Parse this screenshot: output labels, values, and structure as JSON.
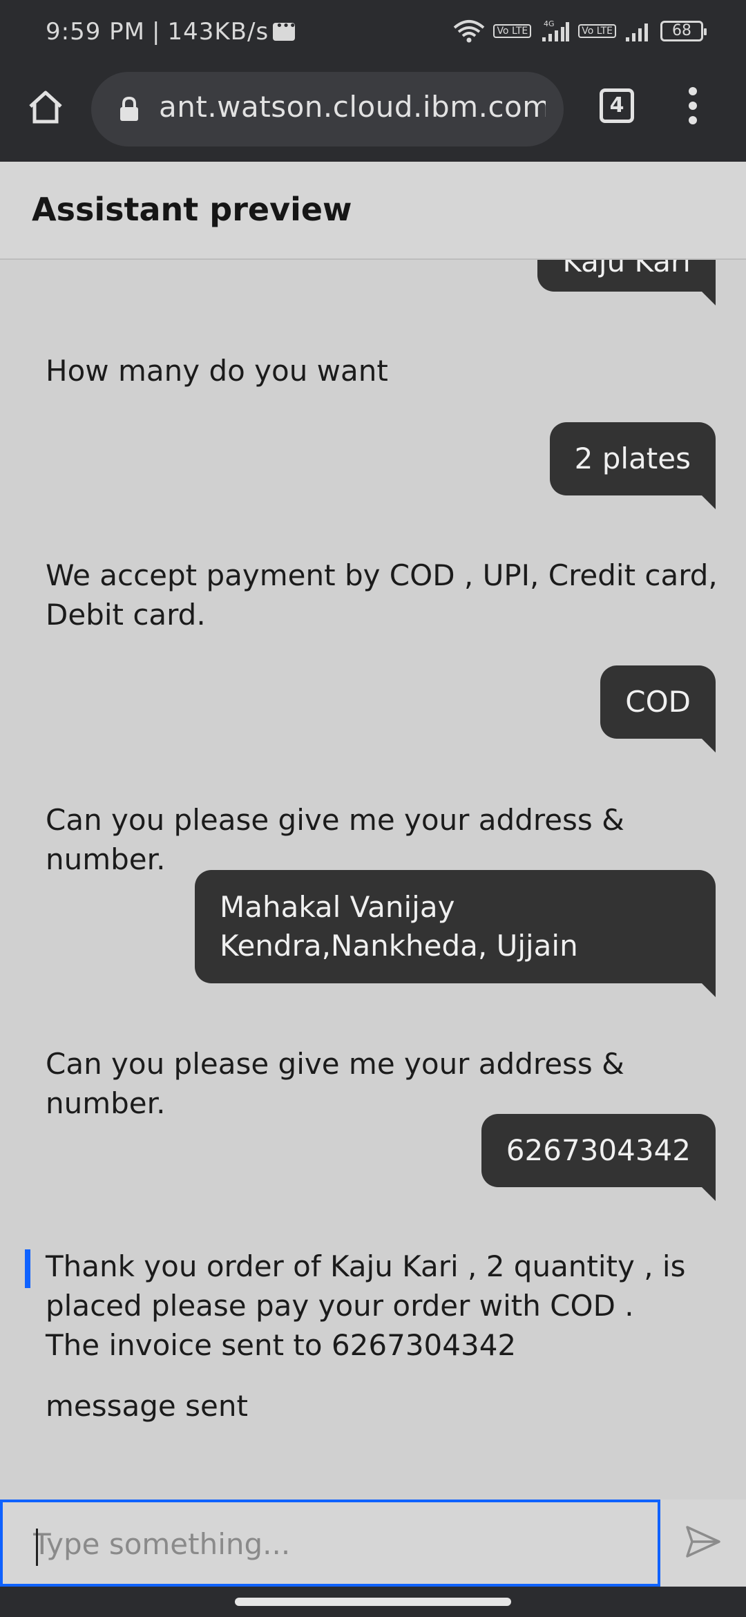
{
  "status_bar": {
    "time": "9:59 PM",
    "speed": "143KB/s",
    "network_label": "4G",
    "volte_label": "Vo LTE",
    "battery": "68"
  },
  "browser": {
    "url": "ant.watson.cloud.ibm.com",
    "tab_count": "4"
  },
  "page": {
    "title": "Assistant preview"
  },
  "chat": {
    "messages": [
      {
        "from": "user",
        "text": "Kaju Kari"
      },
      {
        "from": "bot",
        "text": "How many do you want"
      },
      {
        "from": "user",
        "text": "2 plates"
      },
      {
        "from": "bot",
        "text": "We accept payment by COD , UPI, Credit card, Debit card."
      },
      {
        "from": "user",
        "text": "COD"
      },
      {
        "from": "bot",
        "text": "Can you please give me your address & number."
      },
      {
        "from": "user",
        "text": "Mahakal Vanijay Kendra,Nankheda, Ujjain"
      },
      {
        "from": "bot",
        "text": "Can you please give me your address & number."
      },
      {
        "from": "user",
        "text": "6267304342"
      },
      {
        "from": "bot",
        "text": "Thank you order of Kaju Kari , 2 quantity , is placed please pay your order with COD . The invoice sent to 6267304342"
      },
      {
        "from": "bot",
        "text": "message sent"
      }
    ]
  },
  "input": {
    "placeholder": "Type something...",
    "value": ""
  },
  "colors": {
    "accent": "#0f62fe",
    "user_bubble": "#333333",
    "page_bg": "#d0d0d0",
    "chrome_bg": "#2b2c2f"
  }
}
